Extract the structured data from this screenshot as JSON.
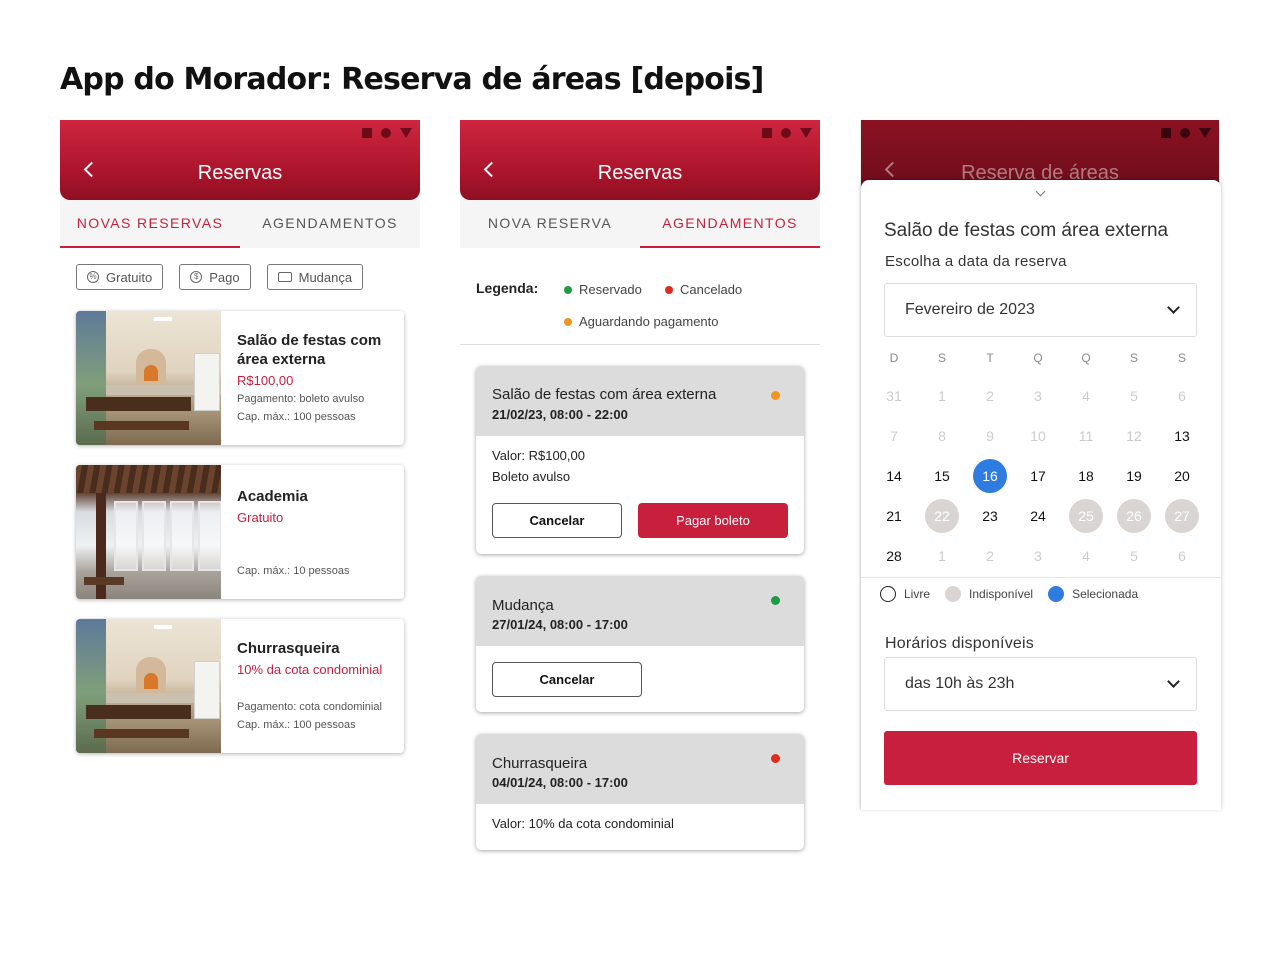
{
  "page_title": "App do Morador: Reserva de áreas [depois]",
  "colors": {
    "brand": "#c8203c",
    "reservado": "#1e9a45",
    "cancelado": "#e02a1a",
    "aguardando": "#f0951f",
    "selecionada": "#2e7ce0",
    "indisponivel": "#dad4d2"
  },
  "screen1": {
    "appbar_title": "Reservas",
    "tabs": [
      {
        "label": "NOVAS RESERVAS",
        "active": true
      },
      {
        "label": "AGENDAMENTOS",
        "active": false
      }
    ],
    "chips": [
      {
        "label": "Gratuito",
        "icon": "percent-icon"
      },
      {
        "label": "Pago",
        "icon": "dollar-icon"
      },
      {
        "label": "Mudança",
        "icon": "truck-icon"
      }
    ],
    "areas": [
      {
        "name": "Salão de festas com área externa",
        "price": "R$100,00",
        "payment": "Pagamento: boleto avulso",
        "capacity": "Cap. máx.: 100 pessoas"
      },
      {
        "name": "Academia",
        "price": "Gratuito",
        "payment": "",
        "capacity": "Cap. máx.: 10 pessoas"
      },
      {
        "name": "Churrasqueira",
        "price": "10% da cota condominial",
        "payment": "Pagamento: cota condominial",
        "capacity": "Cap. máx.: 100 pessoas"
      }
    ]
  },
  "screen2": {
    "appbar_title": "Reservas",
    "tabs": [
      {
        "label": "NOVA RESERVA",
        "active": false
      },
      {
        "label": "AGENDAMENTOS",
        "active": true
      }
    ],
    "legend_label": "Legenda:",
    "legend": [
      {
        "label": "Reservado"
      },
      {
        "label": "Cancelado"
      },
      {
        "label": "Aguardando pagamento"
      }
    ],
    "bookings": [
      {
        "name": "Salão de festas com área externa",
        "date": "21/02/23, 08:00 - 22:00",
        "status": "aguardando",
        "lines": [
          "Valor: R$100,00",
          "Boleto avulso"
        ],
        "cancel_label": "Cancelar",
        "pay_label": "Pagar boleto"
      },
      {
        "name": "Mudança",
        "date": "27/01/24, 08:00 - 17:00",
        "status": "reservado",
        "cancel_label": "Cancelar"
      },
      {
        "name": "Churrasqueira",
        "date": "04/01/24, 08:00 - 17:00",
        "status": "cancelado",
        "lines": [
          "Valor: 10% da cota condominial"
        ]
      }
    ]
  },
  "screen3": {
    "appbar_title": "Reserva de áreas",
    "area_title": "Salão de festas com área externa",
    "date_prompt": "Escolha a data da reserva",
    "month_value": "Fevereiro de 2023",
    "weekdays": [
      "D",
      "S",
      "T",
      "Q",
      "Q",
      "S",
      "S"
    ],
    "weeks": [
      [
        {
          "d": "31",
          "s": "muted"
        },
        {
          "d": "1",
          "s": "muted"
        },
        {
          "d": "2",
          "s": "muted"
        },
        {
          "d": "3",
          "s": "muted"
        },
        {
          "d": "4",
          "s": "muted"
        },
        {
          "d": "5",
          "s": "muted"
        },
        {
          "d": "6",
          "s": "muted"
        }
      ],
      [
        {
          "d": "7",
          "s": "muted"
        },
        {
          "d": "8",
          "s": "muted"
        },
        {
          "d": "9",
          "s": "muted"
        },
        {
          "d": "10",
          "s": "muted"
        },
        {
          "d": "11",
          "s": "muted"
        },
        {
          "d": "12",
          "s": "muted"
        },
        {
          "d": "13",
          "s": "free"
        }
      ],
      [
        {
          "d": "14",
          "s": "free"
        },
        {
          "d": "15",
          "s": "free"
        },
        {
          "d": "16",
          "s": "selected"
        },
        {
          "d": "17",
          "s": "free"
        },
        {
          "d": "18",
          "s": "free"
        },
        {
          "d": "19",
          "s": "free"
        },
        {
          "d": "20",
          "s": "free"
        }
      ],
      [
        {
          "d": "21",
          "s": "free"
        },
        {
          "d": "22",
          "s": "unavailable"
        },
        {
          "d": "23",
          "s": "free"
        },
        {
          "d": "24",
          "s": "free"
        },
        {
          "d": "25",
          "s": "unavailable"
        },
        {
          "d": "26",
          "s": "unavailable"
        },
        {
          "d": "27",
          "s": "unavailable"
        }
      ],
      [
        {
          "d": "28",
          "s": "free"
        },
        {
          "d": "1",
          "s": "muted"
        },
        {
          "d": "2",
          "s": "muted"
        },
        {
          "d": "3",
          "s": "muted"
        },
        {
          "d": "4",
          "s": "muted"
        },
        {
          "d": "5",
          "s": "muted"
        },
        {
          "d": "6",
          "s": "muted"
        }
      ]
    ],
    "legend": [
      {
        "label": "Livre"
      },
      {
        "label": "Indisponível"
      },
      {
        "label": "Selecionada"
      }
    ],
    "hours_label": "Horários disponíveis",
    "hours_value": "das 10h às 23h",
    "reserve_label": "Reservar"
  }
}
